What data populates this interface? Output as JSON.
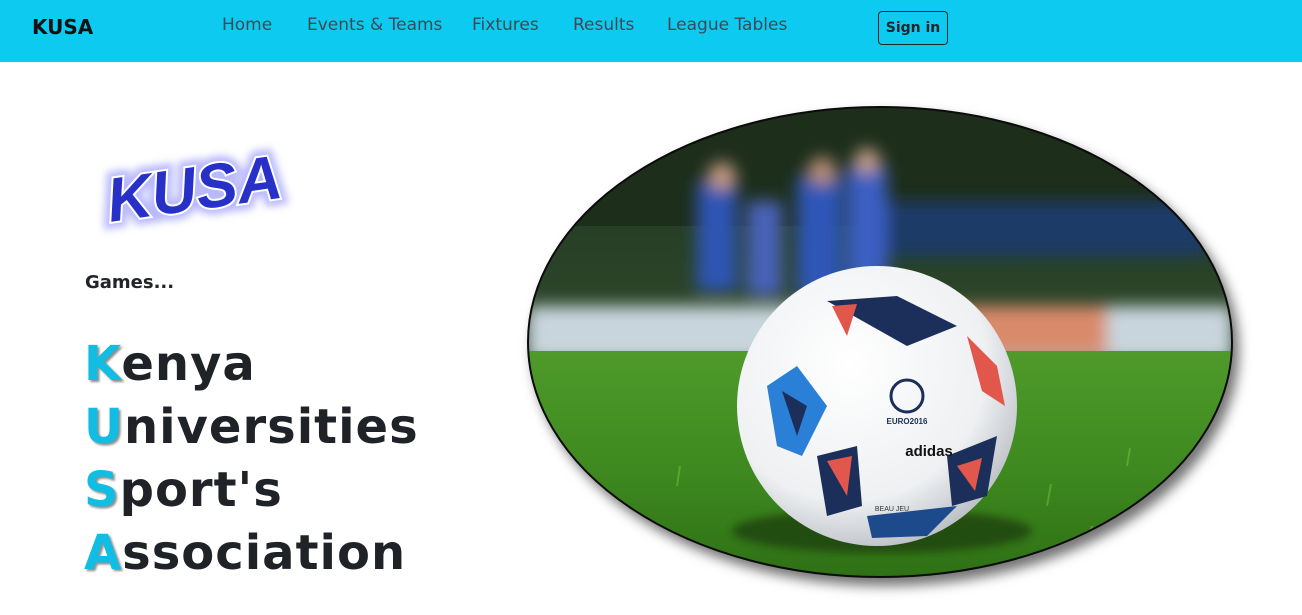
{
  "navbar": {
    "brand": "KUSA",
    "links": [
      "Home",
      "Events & Teams",
      "Fixtures",
      "Results",
      "League Tables"
    ],
    "signin_label": "Sign in",
    "bg_color": "#0dcaf0"
  },
  "hero": {
    "logo_text": "KUSA",
    "tagline": "Games...",
    "name_lines": [
      {
        "initial": "K",
        "rest": "enya"
      },
      {
        "initial": "U",
        "rest": "niversities"
      },
      {
        "initial": "S",
        "rest": "port's"
      },
      {
        "initial": "A",
        "rest": "ssociation"
      }
    ],
    "accent_color": "#12bde3",
    "image": {
      "ball_text_1": "EURO2016",
      "ball_text_2": "adidas",
      "ball_text_3": "BEAU JEU"
    }
  }
}
